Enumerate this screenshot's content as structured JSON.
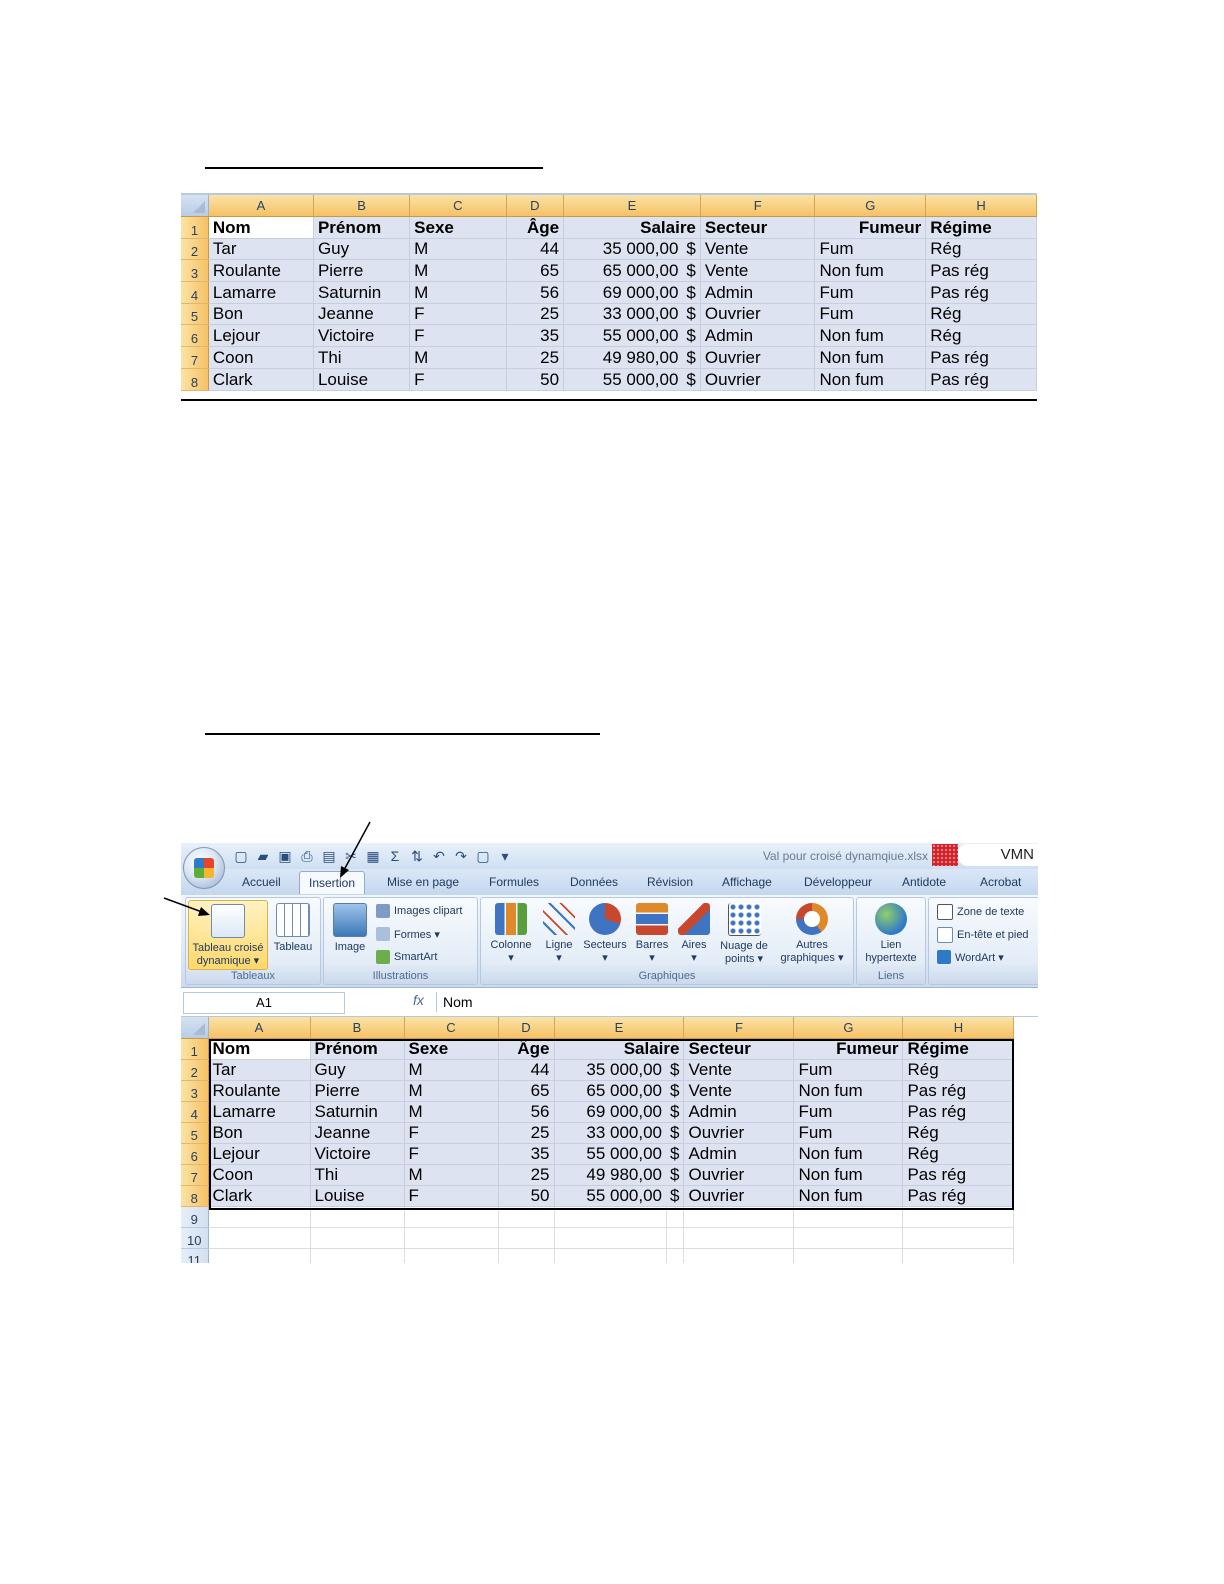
{
  "columns": [
    "A",
    "B",
    "C",
    "D",
    "E",
    "F",
    "G",
    "H"
  ],
  "header": [
    "Nom",
    "Prénom",
    "Sexe",
    "Âge",
    "Salaire",
    "Secteur",
    "Fumeur",
    "Régime"
  ],
  "rows": [
    [
      "Tar",
      "Guy",
      "M",
      "44",
      "35 000,00",
      "$",
      "Vente",
      "Fum",
      "Rég"
    ],
    [
      "Roulante",
      "Pierre",
      "M",
      "65",
      "65 000,00",
      "$",
      "Vente",
      "Non fum",
      "Pas rég"
    ],
    [
      "Lamarre",
      "Saturnin",
      "M",
      "56",
      "69 000,00",
      "$",
      "Admin",
      "Fum",
      "Pas rég"
    ],
    [
      "Bon",
      "Jeanne",
      "F",
      "25",
      "33 000,00",
      "$",
      "Ouvrier",
      "Fum",
      "Rég"
    ],
    [
      "Lejour",
      "Victoire",
      "F",
      "35",
      "55 000,00",
      "$",
      "Admin",
      "Non fum",
      "Rég"
    ],
    [
      "Coon",
      "Thi",
      "M",
      "25",
      "49 980,00",
      "$",
      "Ouvrier",
      " Non fum",
      "Pas rég"
    ],
    [
      "Clark",
      "Louise",
      "F",
      "50",
      "55 000,00",
      "$",
      "Ouvrier",
      " Non fum",
      "Pas rég"
    ]
  ],
  "extra_rows": [
    "9",
    "10",
    "11"
  ],
  "excel": {
    "doc_title": "Val pour croisé dynamqiue.xlsx",
    "corner_text": "VMN",
    "tabs": [
      "Accueil",
      "Insertion",
      "Mise en page",
      "Formules",
      "Données",
      "Révision",
      "Affichage",
      "Développeur",
      "Antidote",
      "Acrobat"
    ],
    "active_tab": "Insertion",
    "groups": {
      "tableaux": {
        "label": "Tableaux",
        "pivot": "Tableau croisé",
        "pivot2": "dynamique ▾",
        "table": "Tableau"
      },
      "illustrations": {
        "label": "Illustrations",
        "image": "Image",
        "clipart": "Images clipart",
        "formes": "Formes ▾",
        "smartart": "SmartArt"
      },
      "graphiques": {
        "label": "Graphiques",
        "colonne": "Colonne",
        "ligne": "Ligne",
        "secteurs": "Secteurs",
        "barres": "Barres",
        "aires": "Aires",
        "nuage": "Nuage de",
        "nuage2": "points ▾",
        "autres": "Autres",
        "autres2": "graphiques ▾"
      },
      "liens": {
        "label": "Liens",
        "lien": "Lien",
        "lien2": "hypertexte"
      },
      "texte": {
        "zone": "Zone de texte",
        "entete": "En-tête et pied",
        "wordart": "WordArt ▾"
      }
    },
    "name_box": "A1",
    "fx": "fx",
    "formula": "Nom"
  },
  "colors": {
    "header_orange": "#f5c165",
    "cell_blue": "#dde3f0"
  }
}
